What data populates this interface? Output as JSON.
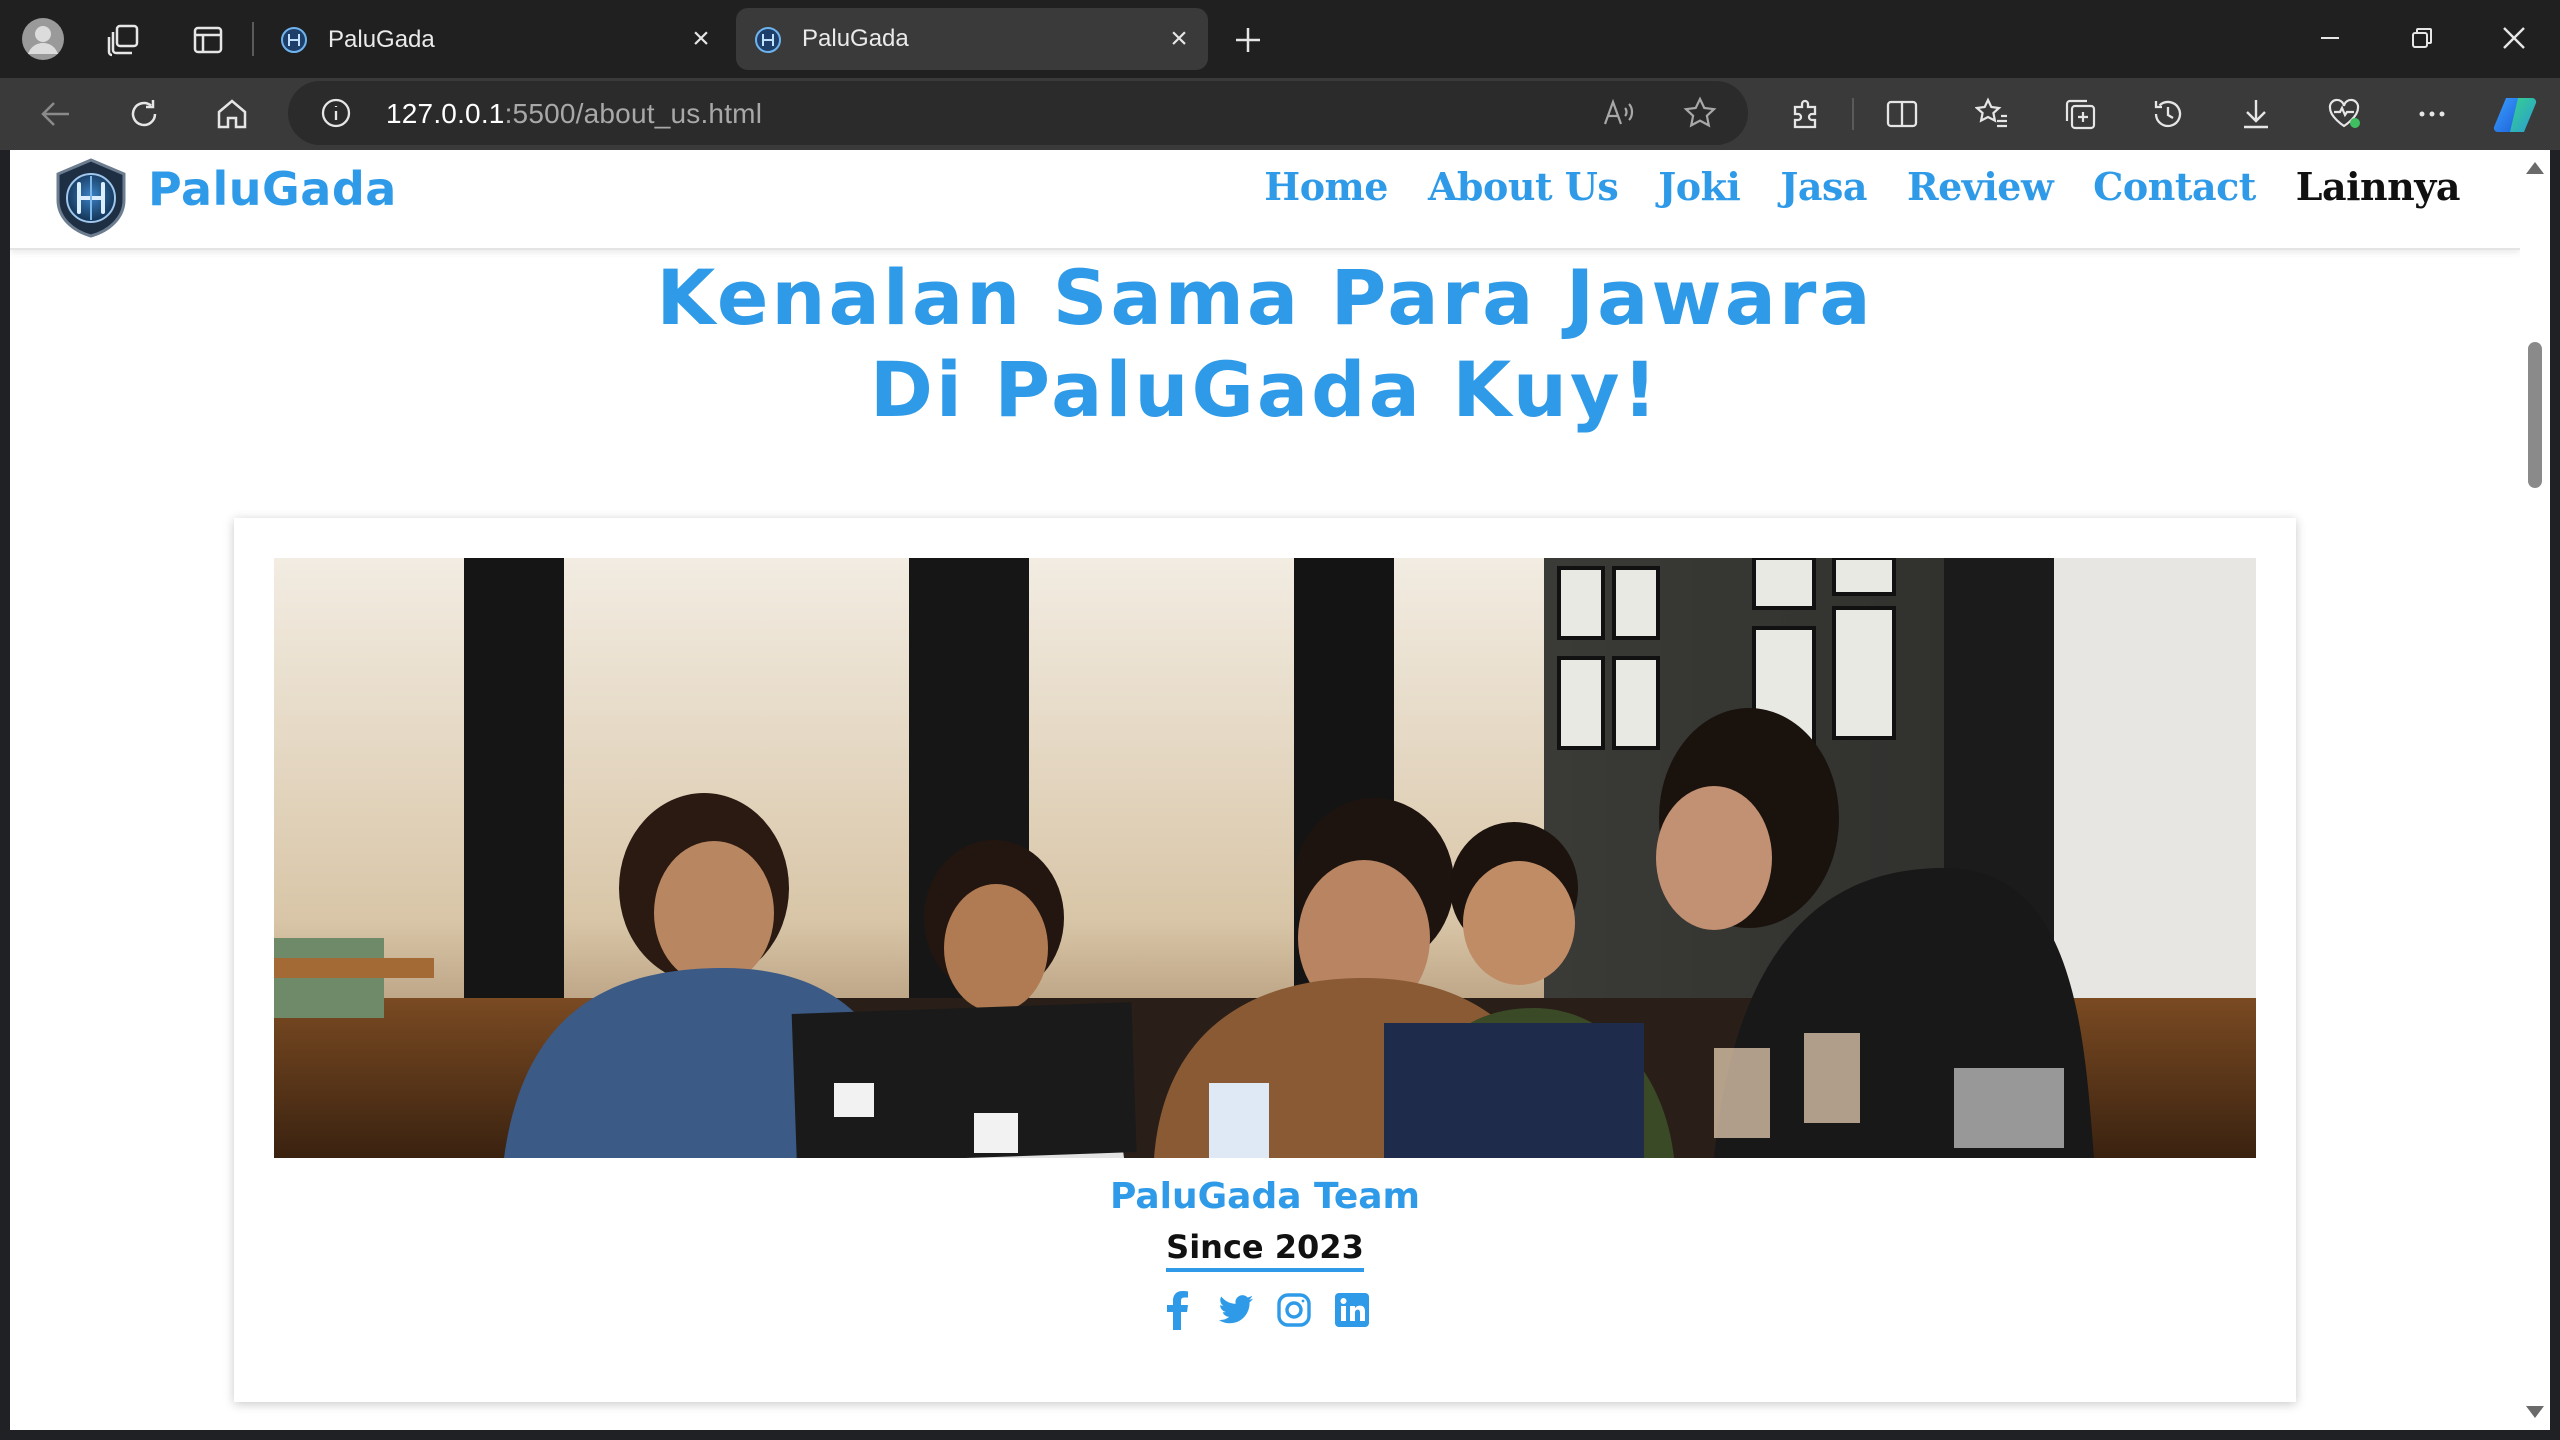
{
  "browser": {
    "tabs": [
      {
        "title": "PaluGada",
        "active": false
      },
      {
        "title": "PaluGada",
        "active": true
      }
    ],
    "address": {
      "host": "127.0.0.1",
      "rest": ":5500/about_us.html"
    },
    "accent": "#2f9be8"
  },
  "navbar": {
    "brand": "PaluGada",
    "links": [
      {
        "label": "Home"
      },
      {
        "label": "About Us"
      },
      {
        "label": "Joki"
      },
      {
        "label": "Jasa"
      },
      {
        "label": "Review"
      },
      {
        "label": "Contact"
      },
      {
        "label": "Lainnya"
      }
    ]
  },
  "hero": {
    "line1": "Kenalan Sama Para Jawara",
    "line2": "Di PaluGada Kuy!"
  },
  "card": {
    "team_name": "PaluGada Team",
    "since": "Since 2023",
    "socials": [
      "facebook-icon",
      "twitter-icon",
      "instagram-icon",
      "linkedin-icon"
    ]
  }
}
